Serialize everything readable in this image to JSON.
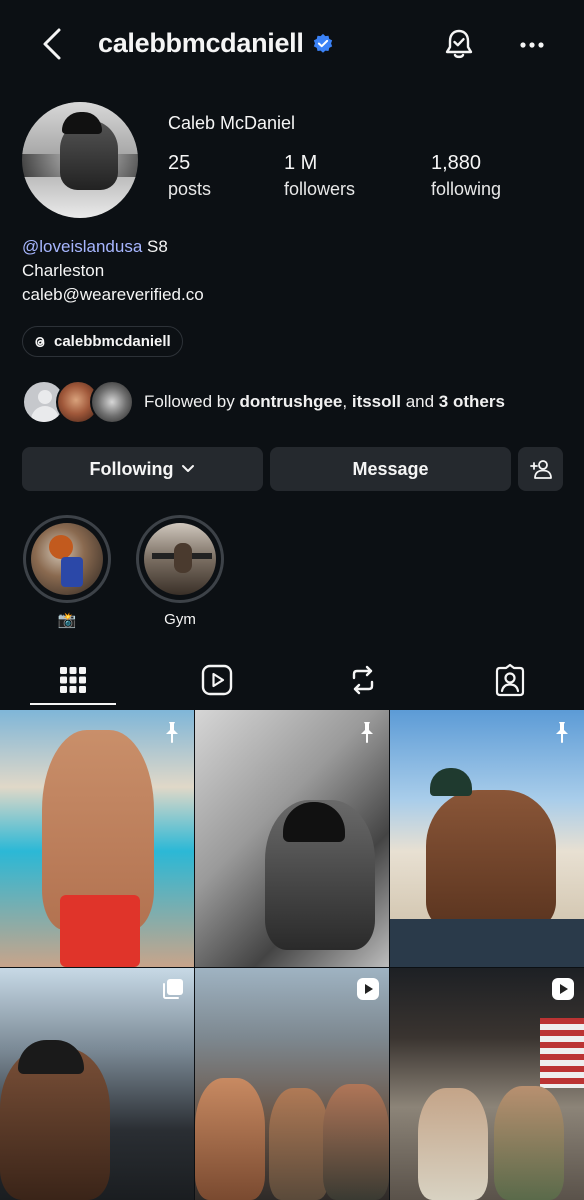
{
  "header": {
    "username": "calebbmcdaniell"
  },
  "profile": {
    "full_name": "Caleb McDaniel",
    "stats": [
      {
        "value": "25",
        "label": "posts"
      },
      {
        "value": "1 M",
        "label": "followers"
      },
      {
        "value": "1,880",
        "label": "following"
      }
    ],
    "bio": {
      "mention": "@loveislandusa",
      "mention_suffix": " S8",
      "line2": "Charleston",
      "line3": "caleb@weareverified.co"
    },
    "threads_handle": "calebbmcdaniell"
  },
  "followed_by": {
    "prefix": "Followed by ",
    "user1": "dontrushgee",
    "sep": ", ",
    "user2": "itssoll",
    "and_text": " and ",
    "others": "3 others"
  },
  "actions": {
    "following": "Following",
    "message": "Message"
  },
  "highlights": [
    {
      "label": "📸"
    },
    {
      "label": "Gym"
    }
  ],
  "tabs": [
    "grid",
    "reels",
    "reposts",
    "tagged"
  ],
  "posts": [
    {
      "badge": "pin-icon"
    },
    {
      "badge": "pin-icon"
    },
    {
      "badge": "pin-icon"
    },
    {
      "badge": "carousel-icon"
    },
    {
      "badge": "reel-icon"
    },
    {
      "badge": "reel-icon"
    }
  ],
  "colors": {
    "background": "#0c1014",
    "button": "#25292e",
    "mention": "#a7b6ff",
    "verified": "#3b82f6"
  }
}
